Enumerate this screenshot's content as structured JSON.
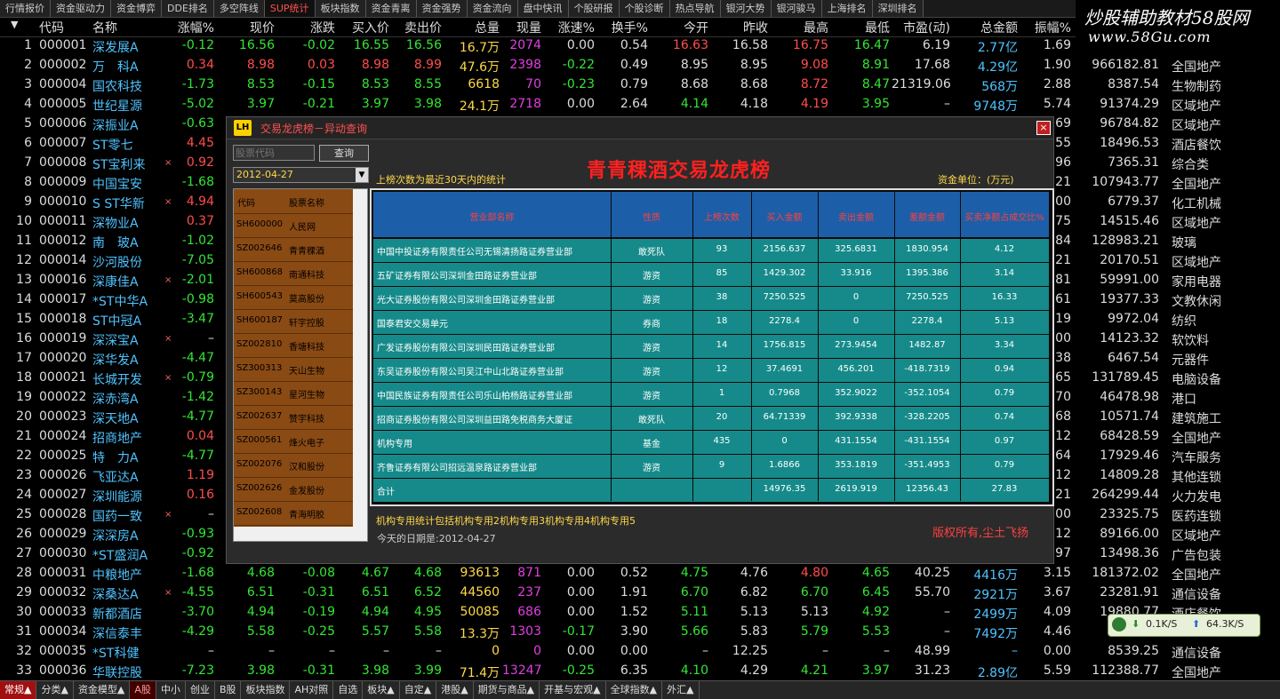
{
  "top_tabs": [
    "行情报价",
    "资金驱动力",
    "资金博弈",
    "DDE排名",
    "多空阵线",
    "SUP统计",
    "板块指数",
    "资金青离",
    "资金强势",
    "资金流向",
    "盘中快讯",
    "个股研报",
    "个股诊断",
    "热点导航",
    "银河大势",
    "银河骏马",
    "上海排名",
    "深圳排名"
  ],
  "active_top_tab": "SUP统计",
  "brand": {
    "line1": "炒股辅助教材58股网",
    "line2": "www.58Gu.com"
  },
  "headers": [
    "代码",
    "名称",
    "涨幅%",
    "现价",
    "涨跌",
    "买入价",
    "卖出价",
    "总量",
    "现量",
    "涨速%",
    "换手%",
    "今开",
    "昨收",
    "最高",
    "最低",
    "市盈(动)",
    "总金额",
    "振幅%"
  ],
  "rows": [
    {
      "i": "1",
      "code": "000001",
      "name": "深发展A",
      "pct": "-0.12",
      "price": "16.56",
      "chg": "-0.02",
      "buy": "16.55",
      "sell": "16.56",
      "vol": "16.7万",
      "cur": "2074",
      "spd": "0.00",
      "turn": "0.54",
      "open": "16.63",
      "prev": "16.58",
      "high": "16.75",
      "low": "16.47",
      "pe": "6.19",
      "amt": "2.77亿",
      "amp": "1.69",
      "cap": "",
      "ind": "",
      "d": "dn",
      "o": "up",
      "h": "up",
      "l": "dn",
      "sp": "nt"
    },
    {
      "i": "2",
      "code": "000002",
      "name": "万　科A",
      "pct": "0.34",
      "price": "8.98",
      "chg": "0.03",
      "buy": "8.98",
      "sell": "8.99",
      "vol": "47.6万",
      "cur": "2398",
      "spd": "-0.22",
      "turn": "0.49",
      "open": "8.95",
      "prev": "8.95",
      "high": "9.08",
      "low": "8.91",
      "pe": "17.68",
      "amt": "4.29亿",
      "amp": "1.90",
      "cap": "966182.81",
      "ind": "全国地产",
      "d": "up",
      "o": "nt",
      "h": "up",
      "l": "dn",
      "sp": "dn"
    },
    {
      "i": "3",
      "code": "000004",
      "name": "国农科技",
      "pct": "-1.73",
      "price": "8.53",
      "chg": "-0.15",
      "buy": "8.53",
      "sell": "8.55",
      "vol": "6618",
      "cur": "70",
      "spd": "-0.23",
      "turn": "0.79",
      "open": "8.68",
      "prev": "8.68",
      "high": "8.72",
      "low": "8.47",
      "pe": "21319.06",
      "amt": "568万",
      "amp": "2.88",
      "cap": "8387.54",
      "ind": "生物制药",
      "d": "dn",
      "o": "nt",
      "h": "up",
      "l": "dn",
      "sp": "dn"
    },
    {
      "i": "4",
      "code": "000005",
      "name": "世纪星源",
      "pct": "-5.02",
      "price": "3.97",
      "chg": "-0.21",
      "buy": "3.97",
      "sell": "3.98",
      "vol": "24.1万",
      "cur": "2718",
      "spd": "0.00",
      "turn": "2.64",
      "open": "4.14",
      "prev": "4.18",
      "high": "4.19",
      "low": "3.95",
      "pe": "–",
      "amt": "9748万",
      "amp": "5.74",
      "cap": "91374.29",
      "ind": "区域地产",
      "d": "dn",
      "o": "dn",
      "h": "up",
      "l": "dn",
      "sp": "nt"
    },
    {
      "i": "5",
      "code": "000006",
      "name": "深振业A",
      "pct": "-0.63",
      "price": "",
      "chg": "",
      "buy": "",
      "sell": "",
      "vol": "",
      "cur": "",
      "spd": "",
      "turn": "",
      "open": "",
      "prev": "",
      "high": "",
      "low": "",
      "pe": "",
      "amt": "",
      "amp": ".69",
      "cap": "96784.82",
      "ind": "区域地产",
      "d": "dn"
    },
    {
      "i": "6",
      "code": "000007",
      "name": "ST零七",
      "pct": "4.45",
      "amp": ".55",
      "cap": "18496.53",
      "ind": "酒店餐饮",
      "d": "up"
    },
    {
      "i": "7",
      "code": "000008",
      "name": "ST宝利来",
      "x": "×",
      "pct": "0.92",
      "amp": ".96",
      "cap": "7365.31",
      "ind": "综合类",
      "d": "up"
    },
    {
      "i": "8",
      "code": "000009",
      "name": "中国宝安",
      "pct": "-1.68",
      "amp": ".21",
      "cap": "107943.77",
      "ind": "全国地产",
      "d": "dn"
    },
    {
      "i": "9",
      "code": "000010",
      "name": "S ST华新",
      "x": "×",
      "pct": "4.94",
      "amp": ".00",
      "cap": "6779.37",
      "ind": "化工机械",
      "d": "up"
    },
    {
      "i": "10",
      "code": "000011",
      "name": "深物业A",
      "pct": "0.37",
      "amp": ".75",
      "cap": "14515.46",
      "ind": "区域地产",
      "d": "up"
    },
    {
      "i": "11",
      "code": "000012",
      "name": "南　玻A",
      "pct": "-1.02",
      "amp": ".84",
      "cap": "128983.21",
      "ind": "玻璃",
      "d": "dn"
    },
    {
      "i": "12",
      "code": "000014",
      "name": "沙河股份",
      "pct": "-7.05",
      "amp": ".21",
      "cap": "20170.51",
      "ind": "区域地产",
      "d": "dn"
    },
    {
      "i": "13",
      "code": "000016",
      "name": "深康佳A",
      "x": "×",
      "pct": "-2.01",
      "amp": ".81",
      "cap": "59991.00",
      "ind": "家用电器",
      "d": "dn"
    },
    {
      "i": "14",
      "code": "000017",
      "name": "*ST中华A",
      "pct": "-0.98",
      "amp": ".61",
      "cap": "19377.33",
      "ind": "文教休闲",
      "d": "dn"
    },
    {
      "i": "15",
      "code": "000018",
      "name": "ST中冠A",
      "pct": "-3.47",
      "amp": ".19",
      "cap": "9972.04",
      "ind": "纺织",
      "d": "dn"
    },
    {
      "i": "16",
      "code": "000019",
      "name": "深深宝A",
      "x": "×",
      "pct": "–",
      "amp": ".00",
      "cap": "14123.32",
      "ind": "软饮料",
      "d": "nt"
    },
    {
      "i": "17",
      "code": "000020",
      "name": "深华发A",
      "pct": "-4.47",
      "amp": ".38",
      "cap": "6467.54",
      "ind": "元器件",
      "d": "dn"
    },
    {
      "i": "18",
      "code": "000021",
      "name": "长城开发",
      "x": "×",
      "pct": "-0.79",
      "amp": ".65",
      "cap": "131789.45",
      "ind": "电脑设备",
      "d": "dn"
    },
    {
      "i": "19",
      "code": "000022",
      "name": "深赤湾A",
      "pct": "-1.42",
      "amp": ".70",
      "cap": "46478.98",
      "ind": "港口",
      "d": "dn"
    },
    {
      "i": "20",
      "code": "000023",
      "name": "深天地A",
      "pct": "-4.77",
      "amp": ".68",
      "cap": "10571.74",
      "ind": "建筑施工",
      "d": "dn"
    },
    {
      "i": "21",
      "code": "000024",
      "name": "招商地产",
      "pct": "0.04",
      "amp": ".12",
      "cap": "68428.59",
      "ind": "全国地产",
      "d": "up"
    },
    {
      "i": "22",
      "code": "000025",
      "name": "特　力A",
      "pct": "-4.77",
      "amp": ".64",
      "cap": "17929.46",
      "ind": "汽车服务",
      "d": "dn"
    },
    {
      "i": "23",
      "code": "000026",
      "name": "飞亚达A",
      "pct": "1.19",
      "amp": ".12",
      "cap": "14809.28",
      "ind": "其他连锁",
      "d": "up"
    },
    {
      "i": "24",
      "code": "000027",
      "name": "深圳能源",
      "pct": "0.16",
      "amp": ".21",
      "cap": "264299.44",
      "ind": "火力发电",
      "d": "up"
    },
    {
      "i": "25",
      "code": "000028",
      "name": "国药一致",
      "x": "×",
      "pct": "–",
      "amp": ".00",
      "cap": "23325.75",
      "ind": "医药连锁",
      "d": "nt"
    },
    {
      "i": "26",
      "code": "000029",
      "name": "深深房A",
      "pct": "-0.93",
      "amp": ".12",
      "cap": "89166.00",
      "ind": "区域地产",
      "d": "dn"
    },
    {
      "i": "27",
      "code": "000030",
      "name": "*ST盛润A",
      "pct": "-0.92",
      "amp": ".97",
      "cap": "13498.36",
      "ind": "广告包装",
      "d": "dn"
    },
    {
      "i": "28",
      "code": "000031",
      "name": "中粮地产",
      "pct": "-1.68",
      "price": "4.68",
      "chg": "-0.08",
      "buy": "4.67",
      "sell": "4.68",
      "vol": "93613",
      "cur": "871",
      "spd": "0.00",
      "turn": "0.52",
      "open": "4.75",
      "prev": "4.76",
      "high": "4.80",
      "low": "4.65",
      "pe": "40.25",
      "amt": "4416万",
      "amp": "3.15",
      "cap": "181372.02",
      "ind": "全国地产",
      "d": "dn",
      "o": "dn",
      "h": "up",
      "l": "dn",
      "sp": "nt"
    },
    {
      "i": "29",
      "code": "000032",
      "name": "深桑达A",
      "x": "×",
      "pct": "-4.55",
      "price": "6.51",
      "chg": "-0.31",
      "buy": "6.51",
      "sell": "6.52",
      "vol": "44560",
      "cur": "237",
      "spd": "0.00",
      "turn": "1.91",
      "open": "6.70",
      "prev": "6.82",
      "high": "6.70",
      "low": "6.45",
      "pe": "55.70",
      "amt": "2921万",
      "amp": "3.67",
      "cap": "23281.91",
      "ind": "通信设备",
      "d": "dn",
      "o": "dn",
      "h": "dn",
      "l": "dn",
      "sp": "nt"
    },
    {
      "i": "30",
      "code": "000033",
      "name": "新都酒店",
      "pct": "-3.70",
      "price": "4.94",
      "chg": "-0.19",
      "buy": "4.94",
      "sell": "4.95",
      "vol": "50085",
      "cur": "686",
      "spd": "0.00",
      "turn": "1.52",
      "open": "5.11",
      "prev": "5.13",
      "high": "5.13",
      "low": "4.92",
      "pe": "–",
      "amt": "2499万",
      "amp": "4.09",
      "cap": "19880.77",
      "ind": "酒店餐饮",
      "d": "dn",
      "o": "dn",
      "h": "nt",
      "l": "dn",
      "sp": "nt"
    },
    {
      "i": "31",
      "code": "000034",
      "name": "深信泰丰",
      "pct": "-4.29",
      "price": "5.58",
      "chg": "-0.25",
      "buy": "5.57",
      "sell": "5.58",
      "vol": "13.3万",
      "cur": "1303",
      "spd": "-0.17",
      "turn": "3.90",
      "open": "5.66",
      "prev": "5.83",
      "high": "5.79",
      "low": "5.53",
      "pe": "–",
      "amt": "7492万",
      "amp": "4.46",
      "cap": "",
      "ind": "",
      "d": "dn",
      "o": "dn",
      "h": "dn",
      "l": "dn",
      "sp": "dn"
    },
    {
      "i": "32",
      "code": "000035",
      "name": "*ST科健",
      "pct": "–",
      "price": "–",
      "chg": "–",
      "buy": "–",
      "sell": "–",
      "vol": "0",
      "cur": "0",
      "spd": "0.00",
      "turn": "0.00",
      "open": "–",
      "prev": "12.25",
      "high": "–",
      "low": "–",
      "pe": "48.99",
      "amt": "–",
      "amp": "0.00",
      "cap": "8539.25",
      "ind": "通信设备",
      "d": "nt",
      "o": "nt",
      "h": "nt",
      "l": "nt",
      "sp": "nt"
    },
    {
      "i": "33",
      "code": "000036",
      "name": "华联控股",
      "pct": "-7.23",
      "price": "3.98",
      "chg": "-0.31",
      "buy": "3.98",
      "sell": "3.99",
      "vol": "71.4万",
      "cur": "13247",
      "spd": "-0.25",
      "turn": "6.35",
      "open": "4.10",
      "prev": "4.29",
      "high": "4.21",
      "low": "3.97",
      "pe": "31.23",
      "amt": "2.89亿",
      "amp": "5.59",
      "cap": "112388.77",
      "ind": "全国地产",
      "d": "dn",
      "o": "dn",
      "h": "dn",
      "l": "dn",
      "sp": "dn"
    }
  ],
  "bottom_tabs": [
    "常规▲",
    "分类▲",
    "资金模型▲",
    "A股",
    "中小",
    "创业",
    "B股",
    "板块指数",
    "AH对照",
    "自选",
    "板块▲",
    "自定▲",
    "港股▲",
    "期货与商品▲",
    "开基与宏观▲",
    "全球指数▲",
    "外汇▲"
  ],
  "net": {
    "down": "0.1K/S",
    "up": "64.3K/S"
  },
  "dialog": {
    "icon": "LH",
    "title": "交易龙虎榜－异动查询",
    "close": "×",
    "input_placeholder": "股票代码",
    "query_label": "查询",
    "date": "2012-04-27",
    "note": "上榜次数为最近30天内的统计",
    "big_title": "青青稞酒交易龙虎榜",
    "unit": "资金单位：(万元)",
    "left_headers": [
      "代码",
      "股票名称"
    ],
    "left_rows": [
      [
        "SH600000",
        "人民网"
      ],
      [
        "SZ002646",
        "青青稞酒"
      ],
      [
        "SH600868",
        "南通科技"
      ],
      [
        "SH600543",
        "莫高股份"
      ],
      [
        "SH600187",
        "轩宇控股"
      ],
      [
        "SZ002810",
        "香塘科技"
      ],
      [
        "SZ300313",
        "天山生物"
      ],
      [
        "SZ300143",
        "星河生物"
      ],
      [
        "SZ002637",
        "赞宇科技"
      ],
      [
        "SZ000561",
        "烽火电子"
      ],
      [
        "SZ002076",
        "汉和股份"
      ],
      [
        "SZ002626",
        "金发股份"
      ],
      [
        "SZ002608",
        "青海明胶"
      ]
    ],
    "table_headers": [
      "营业部名称",
      "性质",
      "上榜次数",
      "买入金额",
      "卖出金额",
      "差额金额",
      "买卖净额占成交比%"
    ],
    "table_rows": [
      [
        "中国中投证券有限责任公司无锡清扬路证券营业部",
        "敢死队",
        "93",
        "2156.637",
        "325.6831",
        "1830.954",
        "4.12"
      ],
      [
        "五矿证券有限公司深圳金田路证券营业部",
        "游资",
        "85",
        "1429.302",
        "33.916",
        "1395.386",
        "3.14"
      ],
      [
        "光大证券股份有限公司深圳金田路证券营业部",
        "游资",
        "38",
        "7250.525",
        "0",
        "7250.525",
        "16.33"
      ],
      [
        "国泰君安交易单元",
        "券商",
        "18",
        "2278.4",
        "0",
        "2278.4",
        "5.13"
      ],
      [
        "广发证券股份有限公司深圳民田路证券营业部",
        "游资",
        "14",
        "1756.815",
        "273.9454",
        "1482.87",
        "3.34"
      ],
      [
        "东吴证券股份有限公司吴江中山北路证券营业部",
        "游资",
        "12",
        "37.4691",
        "456.201",
        "-418.7319",
        "0.94"
      ],
      [
        "中国民族证券有限责任公司乐山柏杨路证券营业部",
        "游资",
        "1",
        "0.7968",
        "352.9022",
        "-352.1054",
        "0.79"
      ],
      [
        "招商证券股份有限公司深圳益田路免税商务大厦证",
        "敢死队",
        "20",
        "64.71339",
        "392.9338",
        "-328.2205",
        "0.74"
      ],
      [
        "机构专用",
        "基金",
        "435",
        "0",
        "431.1554",
        "-431.1554",
        "0.97"
      ],
      [
        "齐鲁证券有限公司招远温泉路证券营业部",
        "游资",
        "9",
        "1.6866",
        "353.1819",
        "-351.4953",
        "0.79"
      ],
      [
        "合计",
        "",
        "",
        "14976.35",
        "2619.919",
        "12356.43",
        "27.83"
      ]
    ],
    "footnote": "机构专用统计包括机构专用2机构专用3机构专用4机构专用5",
    "today": "今天的日期是:2012-04-27",
    "credit": "版权所有,尘土飞扬"
  }
}
